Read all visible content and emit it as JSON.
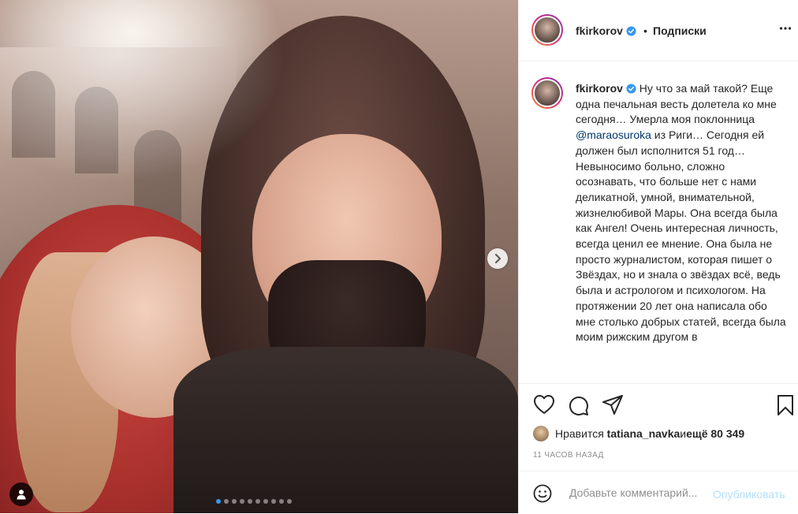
{
  "post": {
    "username": "fkirkorov",
    "separator": "•",
    "follow_label": "Подписки",
    "caption_user": "fkirkorov",
    "caption_part1": " Ну что за май такой? Еще одна печальная весть долетела ко мне сегодня… Умерла моя поклонница ",
    "caption_mention": "@maraosuroka",
    "caption_part2": " из Риги… Сегодня ей должен был исполнится 51 год… Невыносимо больно, сложно осознавать, что больше нет с нами деликатной, умной, внимательной, жизнелюбивой Мары. Она всегда была как Ангел! Очень интересная личность, всегда ценил ее мнение. Она была не просто журналистом, которая пишет о Звёздах, но и знала о звёздах всё, ведь была и астрологом и психологом. На протяжении 20 лет она написала обо мне столько добрых статей, всегда была моим рижским другом в",
    "likes_prefix": "Нравится ",
    "likes_user": "tatiana_navka",
    "likes_middle": " и ",
    "likes_count": "ещё 80 349",
    "time": "11 ЧАСОВ НАЗАД",
    "comment_placeholder": "Добавьте комментарий...",
    "post_label": "Опубликовать"
  },
  "carousel": {
    "slides": 10,
    "active_index": 0
  },
  "colors": {
    "accent": "#3897f0",
    "post_disabled": "#b2dffc",
    "verified": "#3897f0"
  },
  "icons": [
    "verified-icon",
    "more-icon",
    "heart-icon",
    "comment-icon",
    "share-icon",
    "bookmark-icon",
    "emoji-icon",
    "user-tag-icon",
    "chevron-right-icon"
  ]
}
